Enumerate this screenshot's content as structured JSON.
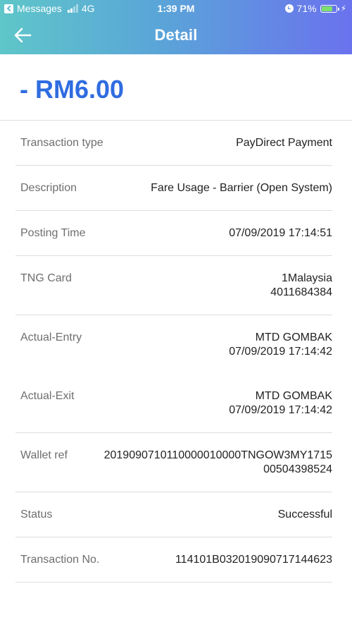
{
  "status_bar": {
    "carrier": "Messages",
    "network": "4G",
    "time": "1:39 PM",
    "battery": "71%",
    "battery_fraction": 0.71
  },
  "nav": {
    "title": "Detail"
  },
  "amount": "- RM6.00",
  "rows": [
    {
      "label": "Transaction type",
      "value": [
        "PayDirect Payment"
      ]
    },
    {
      "label": "Description",
      "value": [
        "Fare Usage - Barrier (Open System)"
      ]
    },
    {
      "label": "Posting Time",
      "value": [
        "07/09/2019 17:14:51"
      ]
    },
    {
      "label": "TNG Card",
      "value": [
        "1Malaysia",
        "4011684384"
      ]
    },
    {
      "label": "Actual-Entry",
      "value": [
        "MTD GOMBAK",
        "07/09/2019 17:14:42"
      ]
    },
    {
      "label": "Actual-Exit",
      "value": [
        "MTD GOMBAK",
        "07/09/2019 17:14:42"
      ]
    },
    {
      "label": "Wallet ref",
      "value": [
        "2019090710110000010000TNGOW3MY1715",
        "00504398524"
      ]
    },
    {
      "label": "Status",
      "value": [
        "Successful"
      ]
    },
    {
      "label": "Transaction No.",
      "value": [
        "114101B032019090717144623"
      ]
    }
  ],
  "colors": {
    "amount": "#2f6ce0",
    "header_gradient_start": "#5fc6c9",
    "header_gradient_end": "#6a72ee"
  }
}
